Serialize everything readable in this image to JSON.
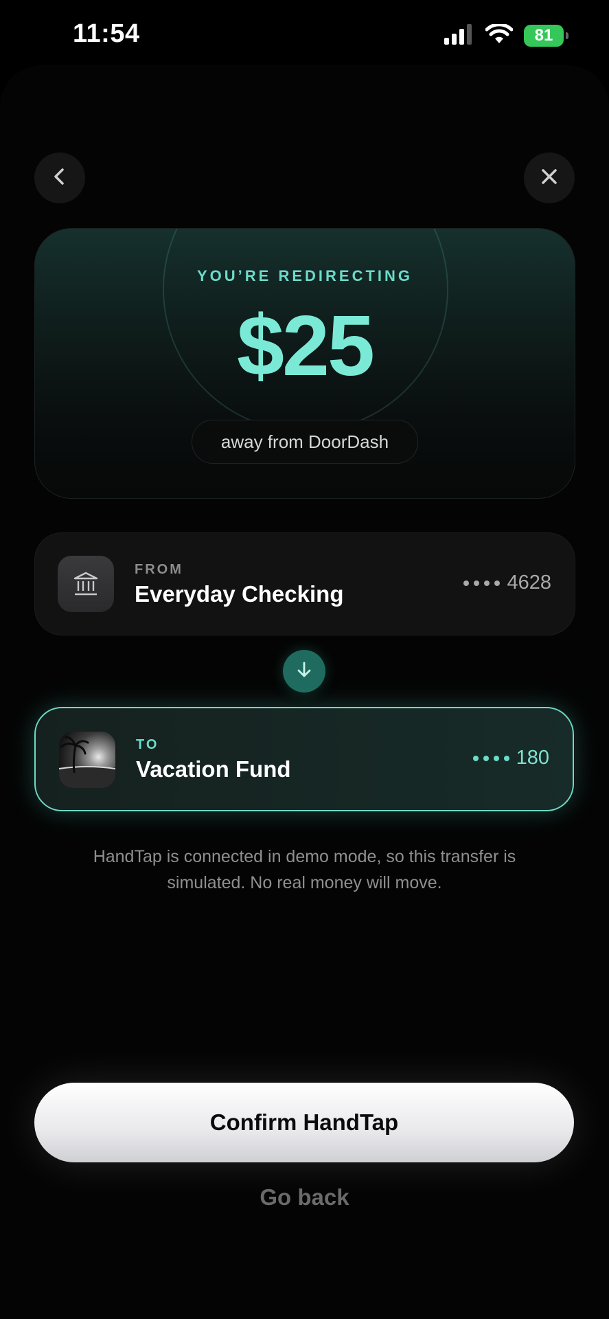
{
  "status_bar": {
    "time": "11:54",
    "battery": "81"
  },
  "nav": {
    "back_icon": "chevron-left-icon",
    "close_icon": "close-icon"
  },
  "hero": {
    "label": "YOU’RE REDIRECTING",
    "amount": "$25",
    "pill": "away from DoorDash"
  },
  "from_account": {
    "label": "FROM",
    "name": "Everyday Checking",
    "last_digits": "4628",
    "icon": "bank-icon",
    "accent": "#8d8d8d"
  },
  "to_account": {
    "label": "TO",
    "name": "Vacation Fund",
    "last_digits": "180",
    "icon": "beach-photo",
    "accent": "#6bdcc9"
  },
  "note": "HandTap is connected in demo mode, so this transfer is simulated. No real money will move.",
  "actions": {
    "confirm_label": "Confirm HandTap",
    "go_back_label": "Go back"
  },
  "colors": {
    "accent": "#7aead6",
    "background": "#040404",
    "battery": "#35c759"
  }
}
